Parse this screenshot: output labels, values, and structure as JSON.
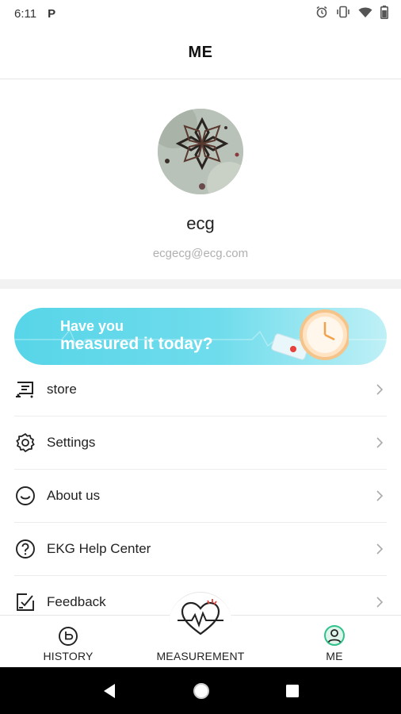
{
  "status_bar": {
    "time": "6:11"
  },
  "header": {
    "title": "ME"
  },
  "profile": {
    "username": "ecg",
    "email": "ecgecg@ecg.com"
  },
  "banner": {
    "line1": "Have you",
    "line2": "measured it today?"
  },
  "menu": [
    {
      "label": "store",
      "icon": "store-icon"
    },
    {
      "label": "Settings",
      "icon": "gear-icon"
    },
    {
      "label": "About us",
      "icon": "smile-icon"
    },
    {
      "label": "EKG Help Center",
      "icon": "help-icon"
    },
    {
      "label": "Feedback",
      "icon": "feedback-icon"
    }
  ],
  "bottom_nav": {
    "history": "HISTORY",
    "measurement": "MEASUREMENT",
    "me": "ME"
  },
  "colors": {
    "accent_green": "#2fc28a",
    "banner_cyan": "#57d5e8",
    "measure_red": "#e8403a"
  }
}
